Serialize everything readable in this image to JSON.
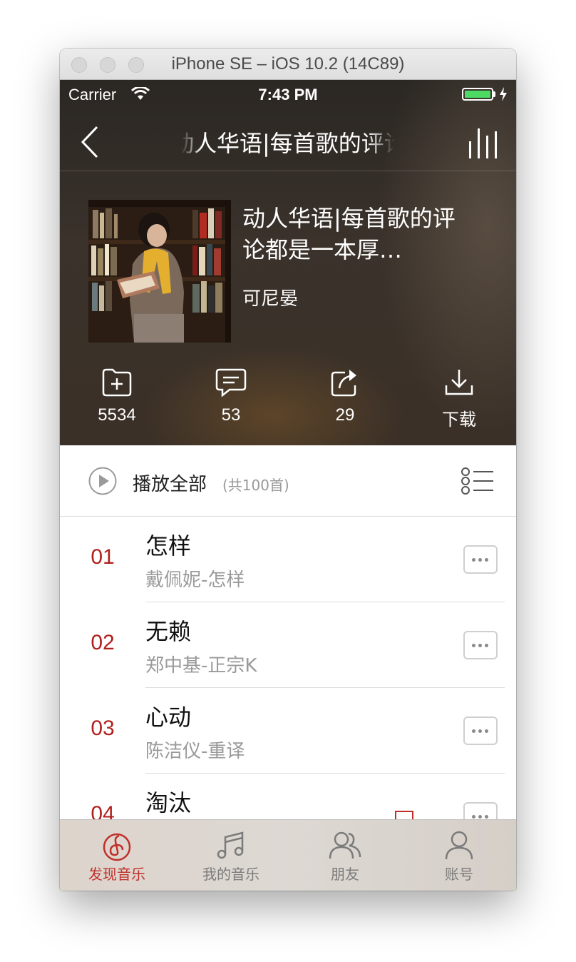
{
  "window": {
    "title": "iPhone SE – iOS 10.2 (14C89)"
  },
  "status_bar": {
    "carrier": "Carrier",
    "time": "7:43 PM"
  },
  "nav": {
    "title": "动人华语|每首歌的评论都是一本厚重的故事书"
  },
  "playlist": {
    "title": "动人华语|每首歌的评论都是一本厚…",
    "creator": "可尼晏"
  },
  "actions": [
    {
      "icon": "add-to-folder-icon",
      "label": "5534"
    },
    {
      "icon": "comment-icon",
      "label": "53"
    },
    {
      "icon": "share-icon",
      "label": "29"
    },
    {
      "icon": "download-icon",
      "label": "下载"
    }
  ],
  "play_all": {
    "label": "播放全部",
    "count": "(共100首)"
  },
  "songs": [
    {
      "num": "01",
      "name": "怎样",
      "sub": "戴佩妮-怎样"
    },
    {
      "num": "02",
      "name": "无赖",
      "sub": "郑中基-正宗K"
    },
    {
      "num": "03",
      "name": "心动",
      "sub": "陈洁仪-重译"
    },
    {
      "num": "04",
      "name": "淘汰",
      "sub": ""
    }
  ],
  "tabs": [
    {
      "icon": "discover-music-icon",
      "label": "发现音乐",
      "active": true
    },
    {
      "icon": "my-music-icon",
      "label": "我的音乐",
      "active": false
    },
    {
      "icon": "friends-icon",
      "label": "朋友",
      "active": false
    },
    {
      "icon": "account-icon",
      "label": "账号",
      "active": false
    }
  ],
  "colors": {
    "accent": "#c0302a",
    "header_bg": "#342d27"
  }
}
